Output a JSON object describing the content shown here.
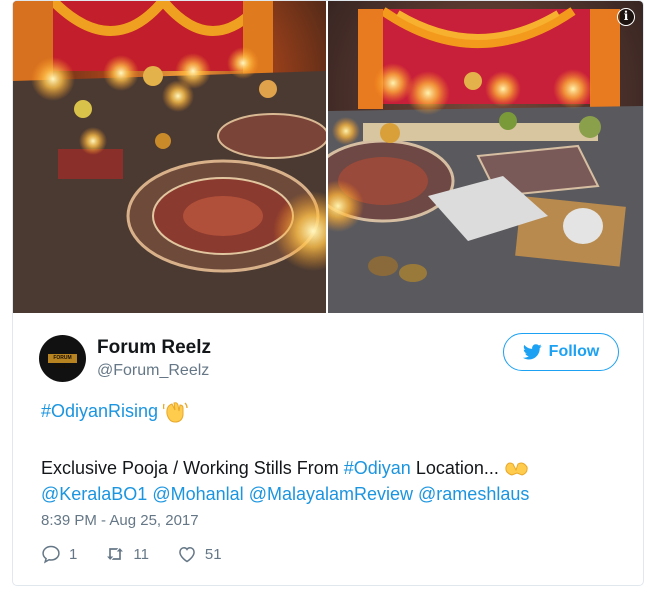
{
  "tweet": {
    "info_icon": "info-icon",
    "author": {
      "name": "Forum Reelz",
      "handle": "@Forum_Reelz",
      "avatar_text": "FORUM REELZ"
    },
    "follow_label": "Follow",
    "hashtag_line": {
      "hashtag": "#OdiyanRising",
      "emoji": "waving-hands-emoji"
    },
    "body": {
      "prefix": "Exclusive Pooja / Working Stills From ",
      "hashtag": "#Odiyan",
      "suffix": " Location...",
      "emoji": "yellow-hands-emoji"
    },
    "mentions": [
      "@KeralaBO1",
      "@Mohanlal",
      "@MalayalamReview",
      "@rameshlaus"
    ],
    "timestamp": "8:39 PM - Aug 25, 2017",
    "stats": {
      "replies": "1",
      "retweets": "11",
      "likes": "51"
    },
    "colors": {
      "accent": "#1da1f2",
      "link": "#1b95e0",
      "muted": "#657786",
      "text": "#14171a"
    }
  }
}
